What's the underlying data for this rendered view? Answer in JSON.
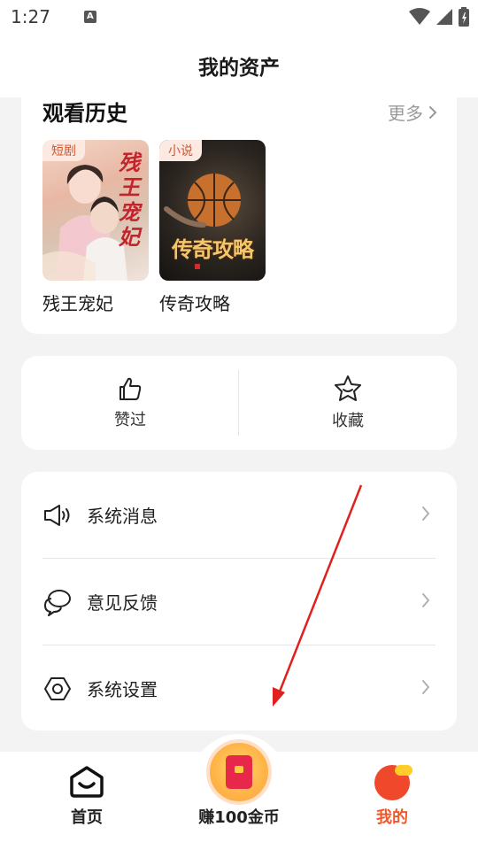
{
  "status_bar": {
    "time": "1:27",
    "a_badge": "A"
  },
  "header": {
    "title": "我的资产"
  },
  "history": {
    "title": "观看历史",
    "more_label": "更多",
    "items": [
      {
        "tag": "短剧",
        "name": "残王宠妃",
        "cover_text": "残王宠妃"
      },
      {
        "tag": "小说",
        "name": "传奇攻略",
        "cover_text": "传奇攻略"
      }
    ]
  },
  "actions": [
    {
      "label": "赞过",
      "icon": "thumbs-up-icon"
    },
    {
      "label": "收藏",
      "icon": "star-icon"
    }
  ],
  "menu": [
    {
      "label": "系统消息",
      "icon": "megaphone-icon"
    },
    {
      "label": "意见反馈",
      "icon": "chat-bubbles-icon"
    },
    {
      "label": "系统设置",
      "icon": "settings-hexagon-icon"
    }
  ],
  "bottom_nav": [
    {
      "label": "首页",
      "icon": "home-icon"
    },
    {
      "label": "赚100金币",
      "icon": "red-envelope-icon"
    },
    {
      "label": "我的",
      "icon": "avatar-icon"
    }
  ],
  "colors": {
    "accent": "#f0582b",
    "tag_bg": "#fbe9e2",
    "tag_text": "#d4572e",
    "annotation_arrow": "#e0201f"
  }
}
